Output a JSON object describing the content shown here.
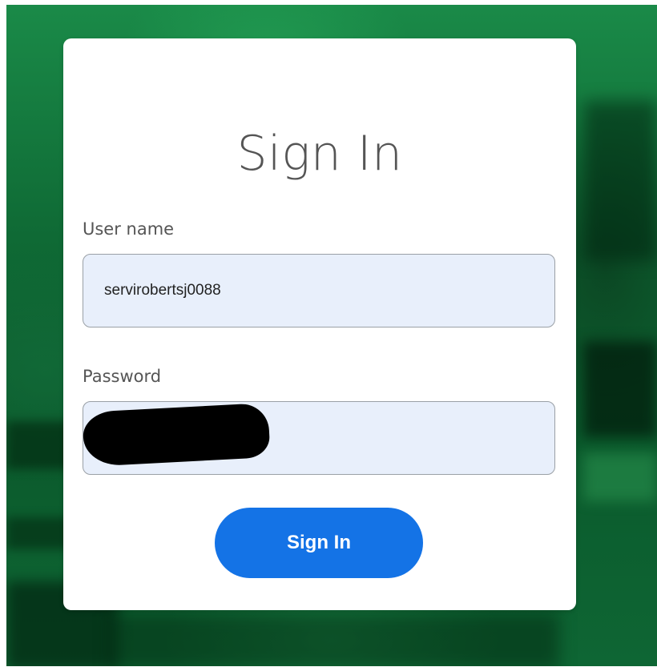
{
  "signin_card": {
    "title": "Sign In",
    "username": {
      "label": "User name",
      "value": "servirobertsj0088"
    },
    "password": {
      "label": "Password",
      "value": ""
    },
    "submit_label": "Sign In"
  },
  "colors": {
    "background": "#0f6a35",
    "card": "#ffffff",
    "input_fill": "#e8effb",
    "button": "#1473e6"
  }
}
